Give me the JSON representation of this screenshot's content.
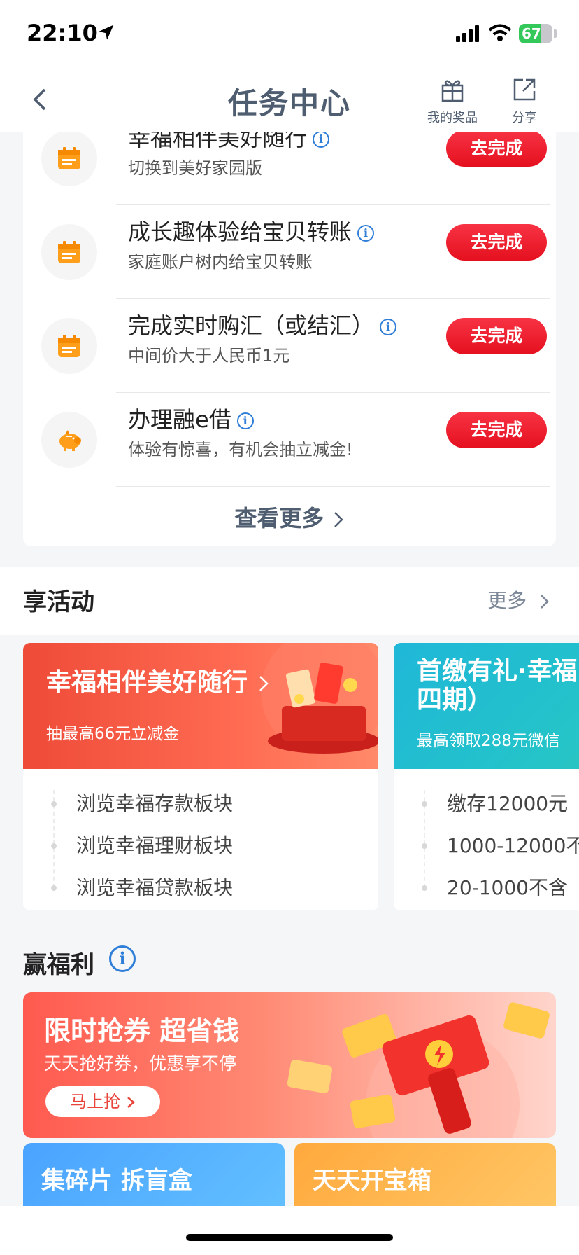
{
  "status_bar": {
    "time": "22:10",
    "battery": "67"
  },
  "nav": {
    "title": "任务中心",
    "prize_label": "我的奖品",
    "share_label": "分享"
  },
  "tasks": [
    {
      "title": "幸福相伴美好随行",
      "subtitle": "切换到美好家园版",
      "button": "去完成",
      "icon": "calendar-icon"
    },
    {
      "title": "成长趣体验给宝贝转账",
      "subtitle": "家庭账户树内给宝贝转账",
      "button": "去完成",
      "icon": "calendar-icon"
    },
    {
      "title": "完成实时购汇（或结汇）",
      "subtitle": "中间价大于人民币1元",
      "button": "去完成",
      "icon": "calendar-icon"
    },
    {
      "title": "办理融e借",
      "subtitle": "体验有惊喜，有机会抽立减金!",
      "button": "去完成",
      "icon": "piggy-bank-icon"
    }
  ],
  "view_more": "查看更多",
  "activities_section": {
    "title": "享活动",
    "more": "更多"
  },
  "activities": [
    {
      "title": "幸福相伴美好随行",
      "subtitle": "抽最高66元立减金",
      "items": [
        "浏览幸福存款板块",
        "浏览幸福理财板块",
        "浏览幸福贷款板块"
      ]
    },
    {
      "title": "首缴有礼·幸福",
      "title_line2": "四期）",
      "subtitle": "最高领取288元微信",
      "items": [
        "缴存12000元",
        "1000-12000不",
        "20-1000不含"
      ]
    }
  ],
  "welfare_section": {
    "title": "赢福利"
  },
  "welfare_banner": {
    "title": "限时抢券 超省钱",
    "subtitle": "天天抢好券，优惠享不停",
    "button": "马上抢"
  },
  "mini_cards": [
    {
      "title": "集碎片 拆盲盒"
    },
    {
      "title": "天天开宝箱"
    }
  ],
  "colors": {
    "accent_red": "#e5101f",
    "info_blue": "#2f7ed8",
    "title_gray": "#4f5d70"
  }
}
